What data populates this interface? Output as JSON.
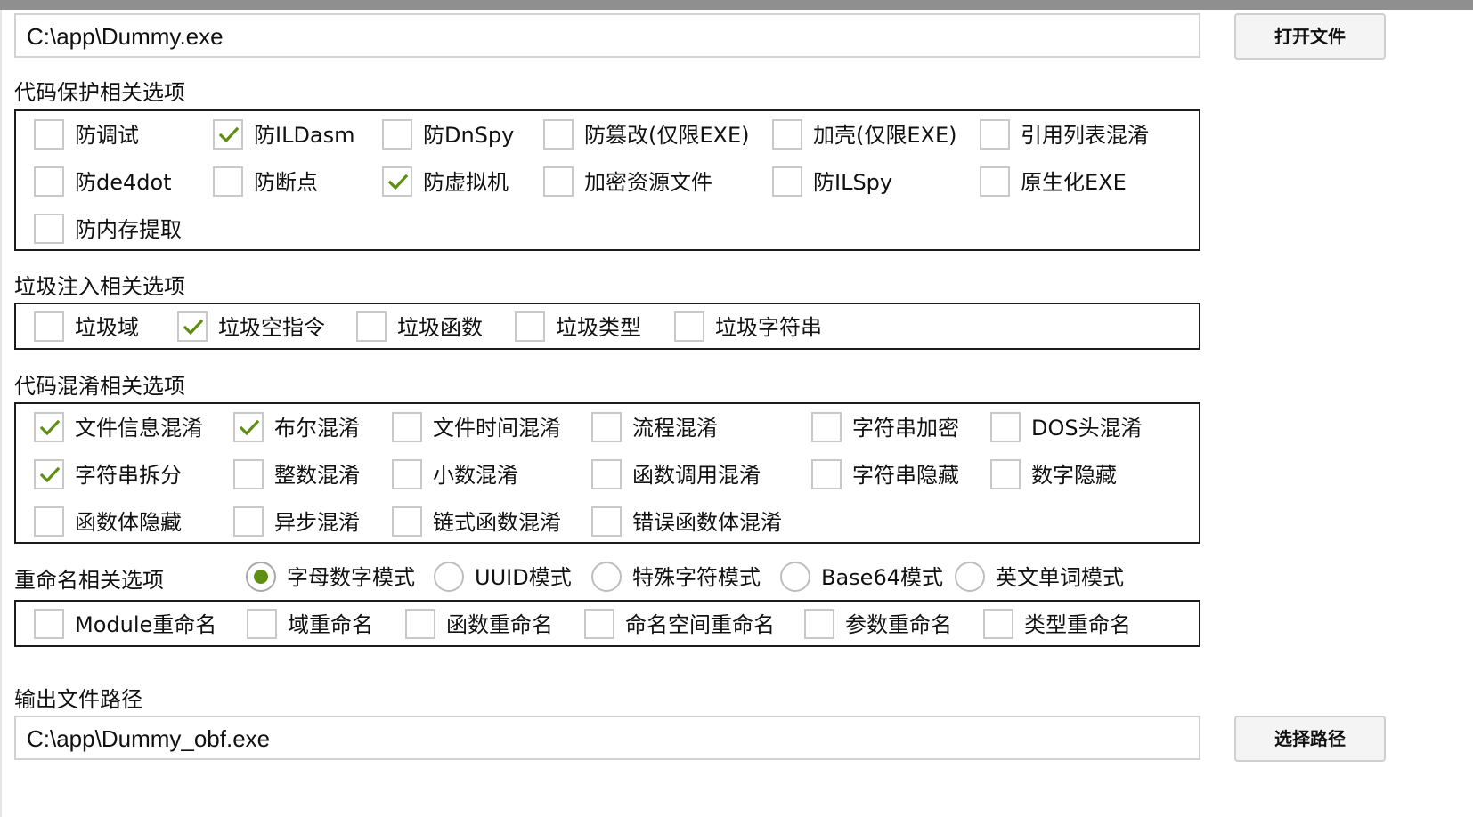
{
  "input_file": {
    "path": "C:\\app\\Dummy.exe",
    "open_button": "打开文件"
  },
  "code_protection": {
    "title": "代码保护相关选项",
    "options": [
      {
        "label": "防调试",
        "checked": false
      },
      {
        "label": "防ILDasm",
        "checked": true
      },
      {
        "label": "防DnSpy",
        "checked": false
      },
      {
        "label": "防篡改(仅限EXE)",
        "checked": false
      },
      {
        "label": "加壳(仅限EXE)",
        "checked": false
      },
      {
        "label": "引用列表混淆",
        "checked": false
      },
      {
        "label": "防de4dot",
        "checked": false
      },
      {
        "label": "防断点",
        "checked": false
      },
      {
        "label": "防虚拟机",
        "checked": true
      },
      {
        "label": "加密资源文件",
        "checked": false
      },
      {
        "label": "防ILSpy",
        "checked": false
      },
      {
        "label": "原生化EXE",
        "checked": false
      },
      {
        "label": "防内存提取",
        "checked": false
      }
    ]
  },
  "junk_injection": {
    "title": "垃圾注入相关选项",
    "options": [
      {
        "label": "垃圾域",
        "checked": false
      },
      {
        "label": "垃圾空指令",
        "checked": true
      },
      {
        "label": "垃圾函数",
        "checked": false
      },
      {
        "label": "垃圾类型",
        "checked": false
      },
      {
        "label": "垃圾字符串",
        "checked": false
      }
    ]
  },
  "obfuscation": {
    "title": "代码混淆相关选项",
    "options": [
      {
        "label": "文件信息混淆",
        "checked": true
      },
      {
        "label": "布尔混淆",
        "checked": true
      },
      {
        "label": "文件时间混淆",
        "checked": false
      },
      {
        "label": "流程混淆",
        "checked": false
      },
      {
        "label": "字符串加密",
        "checked": false
      },
      {
        "label": "DOS头混淆",
        "checked": false
      },
      {
        "label": "字符串拆分",
        "checked": true
      },
      {
        "label": "整数混淆",
        "checked": false
      },
      {
        "label": "小数混淆",
        "checked": false
      },
      {
        "label": "函数调用混淆",
        "checked": false
      },
      {
        "label": "字符串隐藏",
        "checked": false
      },
      {
        "label": "数字隐藏",
        "checked": false
      },
      {
        "label": "函数体隐藏",
        "checked": false
      },
      {
        "label": "异步混淆",
        "checked": false
      },
      {
        "label": "链式函数混淆",
        "checked": false
      },
      {
        "label": "错误函数体混淆",
        "checked": false
      }
    ]
  },
  "rename": {
    "title": "重命名相关选项",
    "modes": [
      {
        "label": "字母数字模式",
        "selected": true
      },
      {
        "label": "UUID模式",
        "selected": false
      },
      {
        "label": "特殊字符模式",
        "selected": false
      },
      {
        "label": "Base64模式",
        "selected": false
      },
      {
        "label": "英文单词模式",
        "selected": false
      }
    ],
    "options": [
      {
        "label": "Module重命名",
        "checked": false
      },
      {
        "label": "域重命名",
        "checked": false
      },
      {
        "label": "函数重命名",
        "checked": false
      },
      {
        "label": "命名空间重命名",
        "checked": false
      },
      {
        "label": "参数重命名",
        "checked": false
      },
      {
        "label": "类型重命名",
        "checked": false
      }
    ]
  },
  "output": {
    "title": "输出文件路径",
    "path": "C:\\app\\Dummy_obf.exe",
    "select_button": "选择路径"
  },
  "colors": {
    "check_green": "#5f8f12",
    "group_border": "#1c1c1c",
    "top_bar": "#8f8f8f"
  }
}
